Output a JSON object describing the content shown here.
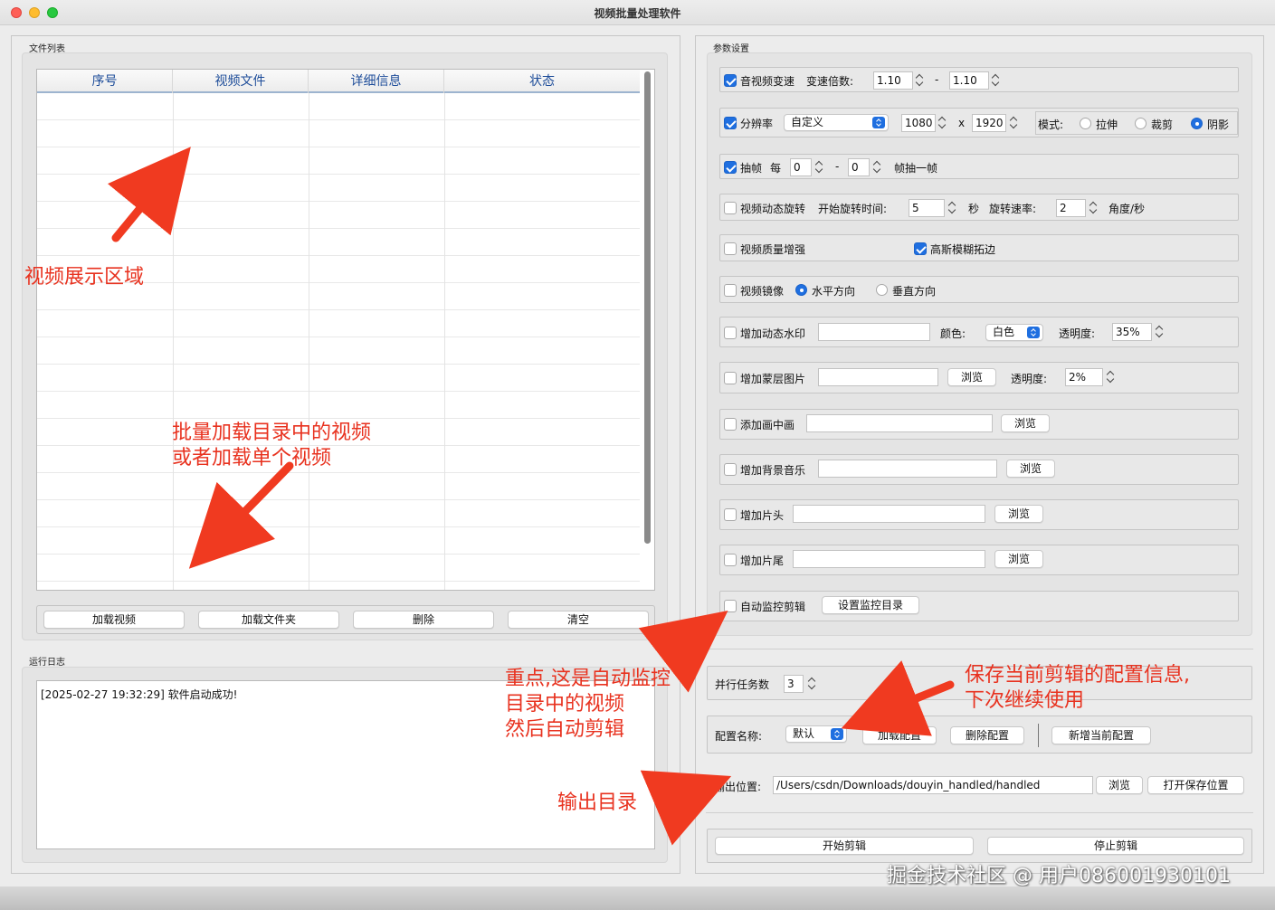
{
  "window": {
    "title": "视频批量处理软件"
  },
  "file_list": {
    "group_title": "文件列表",
    "columns": [
      "序号",
      "视频文件",
      "详细信息",
      "状态"
    ],
    "rows": []
  },
  "buttons": {
    "load_video": "加载视频",
    "load_folder": "加载文件夹",
    "delete": "删除",
    "clear": "清空"
  },
  "log": {
    "group_title": "运行日志",
    "lines": [
      "[2025-02-27 19:32:29] 软件启动成功!"
    ]
  },
  "params": {
    "group_title": "参数设置",
    "speed": {
      "checked": true,
      "label": "音视频变速",
      "sub_label": "变速倍数:",
      "min": "1.10",
      "dash": "-",
      "max": "1.10"
    },
    "resolution": {
      "checked": true,
      "label": "分辨率",
      "preset": "自定义",
      "width": "1080",
      "x": "x",
      "height": "1920",
      "mode_label": "模式:",
      "modes": [
        "拉伸",
        "裁剪",
        "阴影"
      ],
      "selected_mode": "阴影"
    },
    "frame": {
      "checked": true,
      "label": "抽帧",
      "every": "每",
      "min": "0",
      "dash": "-",
      "max": "0",
      "suffix": "帧抽一帧"
    },
    "rotate": {
      "checked": false,
      "label": "视频动态旋转",
      "start_label": "开始旋转时间:",
      "start": "5",
      "sec": "秒",
      "rate_label": "旋转速率:",
      "rate": "2",
      "unit": "角度/秒"
    },
    "quality": {
      "checked": false,
      "label": "视频质量增强",
      "blur_checked": true,
      "blur_label": "高斯模糊拓边"
    },
    "mirror": {
      "checked": false,
      "label": "视频镜像",
      "options": [
        "水平方向",
        "垂直方向"
      ],
      "selected": "水平方向"
    },
    "watermark": {
      "checked": false,
      "label": "增加动态水印",
      "value": "",
      "color_label": "颜色:",
      "color": "白色",
      "opacity_label": "透明度:",
      "opacity": "35%"
    },
    "overlay": {
      "checked": false,
      "label": "增加蒙层图片",
      "value": "",
      "browse": "浏览",
      "opacity_label": "透明度:",
      "opacity": "2%"
    },
    "pip": {
      "checked": false,
      "label": "添加画中画",
      "value": "",
      "browse": "浏览"
    },
    "music": {
      "checked": false,
      "label": "增加背景音乐",
      "value": "",
      "browse": "浏览"
    },
    "intro": {
      "checked": false,
      "label": "增加片头",
      "value": "",
      "browse": "浏览"
    },
    "outro": {
      "checked": false,
      "label": "增加片尾",
      "value": "",
      "browse": "浏览"
    },
    "monitor": {
      "checked": false,
      "label": "自动监控剪辑",
      "button": "设置监控目录"
    }
  },
  "parallel": {
    "label": "并行任务数",
    "value": "3"
  },
  "config": {
    "label": "配置名称:",
    "selected": "默认",
    "load": "加载配置",
    "delete": "删除配置",
    "add": "新增当前配置"
  },
  "output": {
    "label": "输出位置:",
    "path": "/Users/csdn/Downloads/douyin_handled/handled",
    "browse": "浏览",
    "open": "打开保存位置"
  },
  "actions": {
    "start": "开始剪辑",
    "stop": "停止剪辑"
  },
  "annotations": {
    "display_area": "视频展示区域",
    "batch_load_1": "批量加载目录中的视频",
    "batch_load_2": "或者加载单个视频",
    "monitor_1": "重点,这是自动监控",
    "monitor_2": "目录中的视频",
    "monitor_3": "然后自动剪辑",
    "save_config_1": "保存当前剪辑的配置信息,",
    "save_config_2": "下次继续使用",
    "output_dir": "输出目录"
  },
  "watermark_text": "掘金技术社区 @ 用户086001930101",
  "colors": {
    "accent": "#1f6fe0",
    "annotation": "#e8321f",
    "header_text": "#1d4c99"
  }
}
